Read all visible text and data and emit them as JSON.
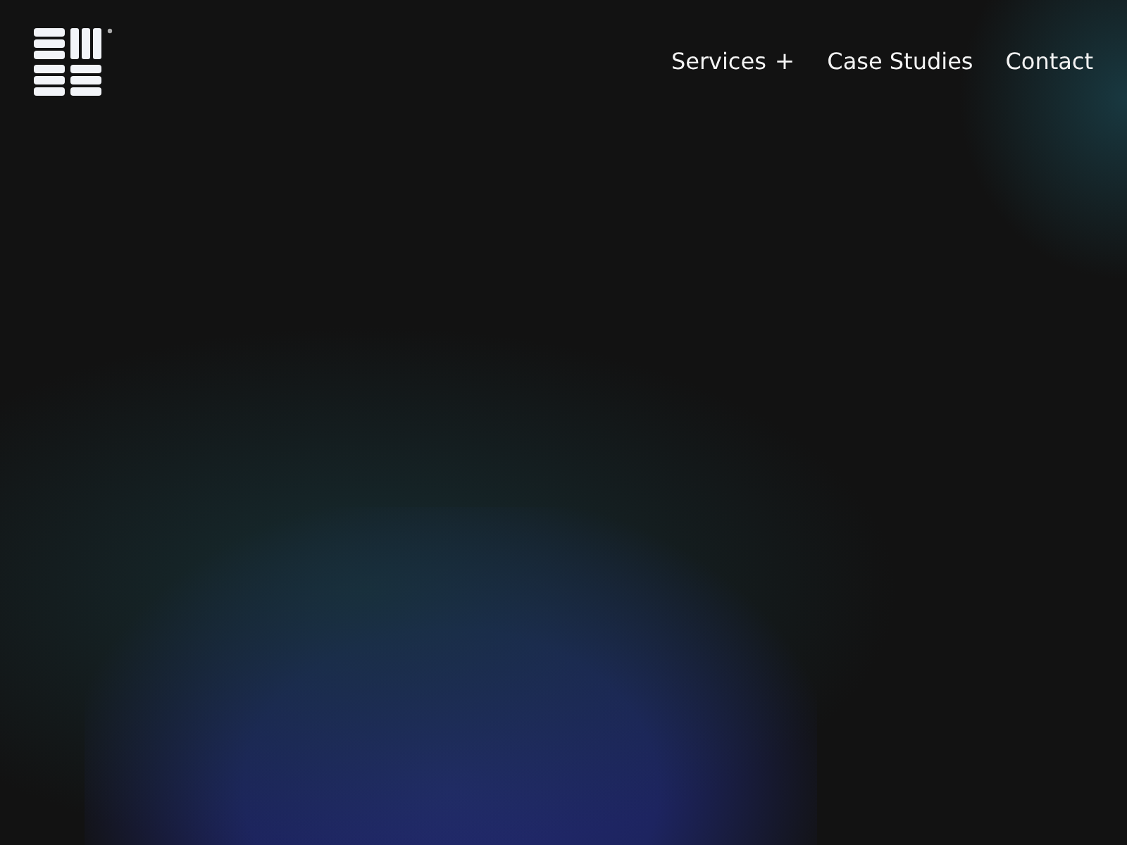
{
  "nav": [
    {
      "label": "Services",
      "expander": "+"
    },
    {
      "label": "Case Studies"
    },
    {
      "label": "Contact"
    }
  ]
}
